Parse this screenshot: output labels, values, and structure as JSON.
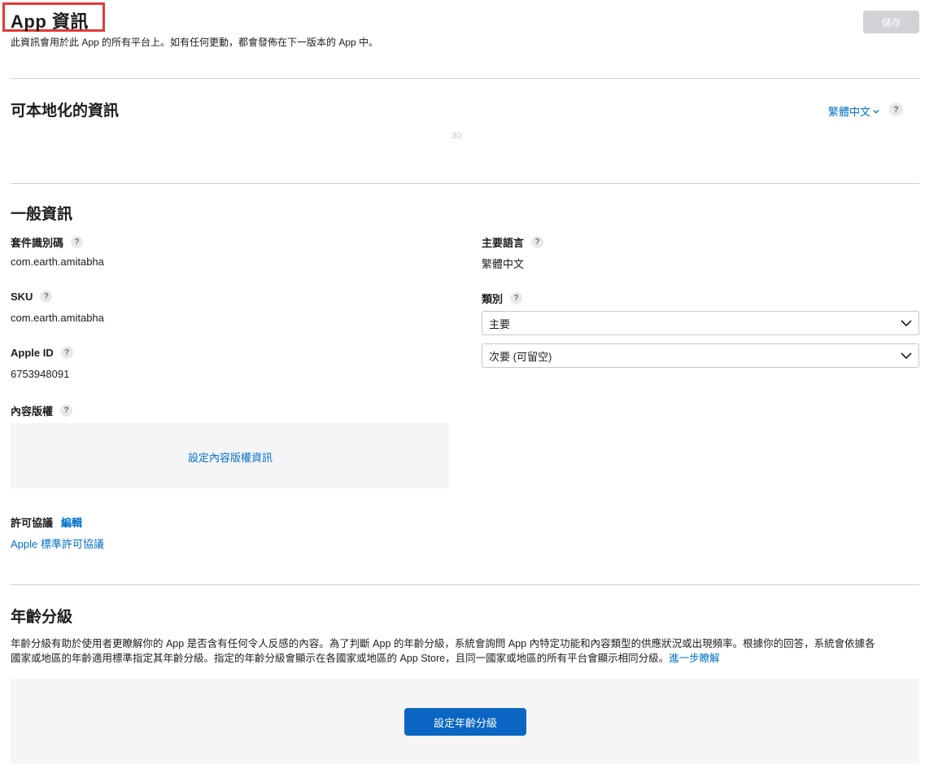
{
  "header": {
    "title": "App 資訊",
    "subtitle": "此資訊會用於此 App 的所有平台上。如有任何更動，都會發佈在下一版本的 App 中。",
    "save_label": "儲存"
  },
  "localizable": {
    "title": "可本地化的資訊",
    "language": "繁體中文",
    "faint_counter": "30"
  },
  "general": {
    "title": "一般資訊",
    "bundle_id_label": "套件識別碼",
    "bundle_id_value": "com.earth.amitabha",
    "sku_label": "SKU",
    "sku_value": "com.earth.amitabha",
    "apple_id_label": "Apple ID",
    "apple_id_value": "6753948091",
    "copyright_label": "內容版權",
    "copyright_link": "設定內容版權資訊",
    "license_label": "許可協議",
    "license_edit": "編輯",
    "license_value": "Apple 標準許可協議",
    "primary_language_label": "主要語言",
    "primary_language_value": "繁體中文",
    "category_label": "類別",
    "primary_category": "主要",
    "secondary_category": "次要 (可留空)"
  },
  "age_rating": {
    "title": "年齡分級",
    "description": "年齡分級有助於使用者更瞭解你的 App 是否含有任何令人反感的內容。為了判斷 App 的年齡分級，系統會詢問 App 內特定功能和內容類型的供應狀況或出現頻率。根據你的回答，系統會依據各國家或地區的年齡適用標準指定其年齡分級。指定的年齡分級會顯示在各國家或地區的 App Store，且同一國家或地區的所有平台會顯示相同分級。",
    "learn_more": "進一步瞭解",
    "button_label": "設定年齡分級"
  },
  "help_glyph": "?",
  "colors": {
    "accent": "#0070c9",
    "primary_button": "#0a66c2",
    "disabled_button": "#d1d1d6",
    "highlight_border": "#e23a36",
    "panel": "#f5f5f7"
  }
}
